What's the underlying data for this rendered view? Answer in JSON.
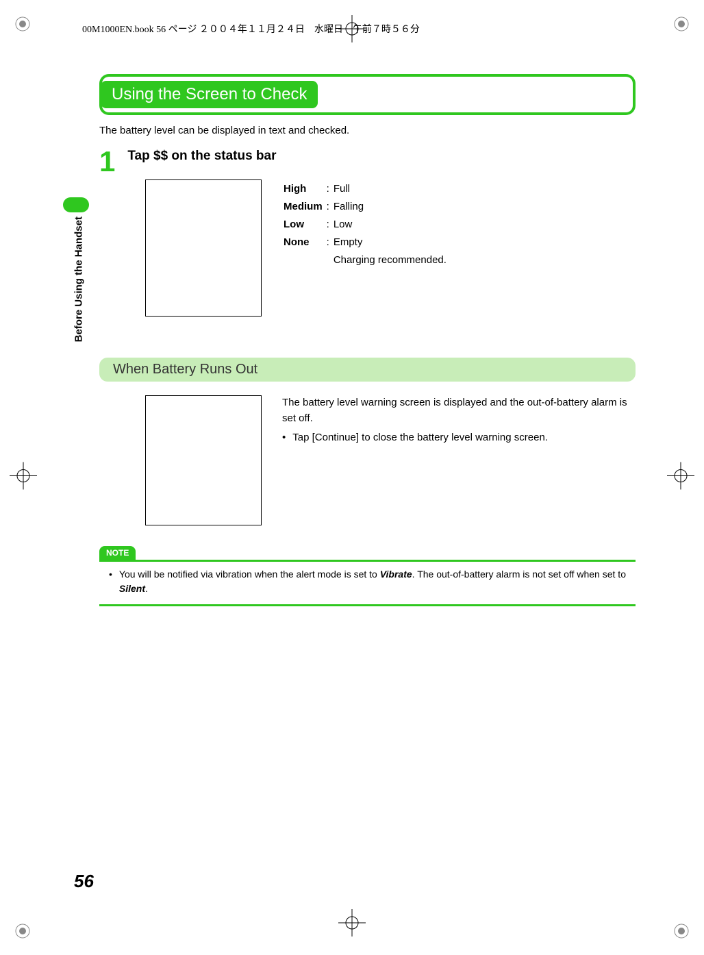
{
  "print_header": "00M1000EN.book  56 ページ  ２００４年１１月２４日　水曜日　午前７時５６分",
  "side_label": "Before Using the Handset",
  "main_heading": "Using the Screen to Check",
  "intro": "The battery level can be displayed in text and checked.",
  "step": {
    "number": "1",
    "title": "Tap $$ on the status bar"
  },
  "legend": [
    {
      "label": "High",
      "sep": ":",
      "desc": "Full"
    },
    {
      "label": "Medium",
      "sep": ":",
      "desc": "Falling"
    },
    {
      "label": "Low",
      "sep": ":",
      "desc": "Low"
    },
    {
      "label": "None",
      "sep": ":",
      "desc": "Empty"
    }
  ],
  "legend_extra": "Charging recommended.",
  "sub_heading": "When Battery Runs Out",
  "battery_out": {
    "p1": "The battery level warning screen is displayed and the out-of-battery alarm is set off.",
    "bullet": "•",
    "p2": "Tap [Continue] to close the battery level warning screen."
  },
  "note": {
    "label": "NOTE",
    "bullet": "•",
    "text_a": "You will be notified via vibration when the alert mode is set to ",
    "vibrate": "Vibrate",
    "text_b": ". The out-of-battery alarm is not set off when set to ",
    "silent": "Silent",
    "text_c": "."
  },
  "page_number": "56"
}
